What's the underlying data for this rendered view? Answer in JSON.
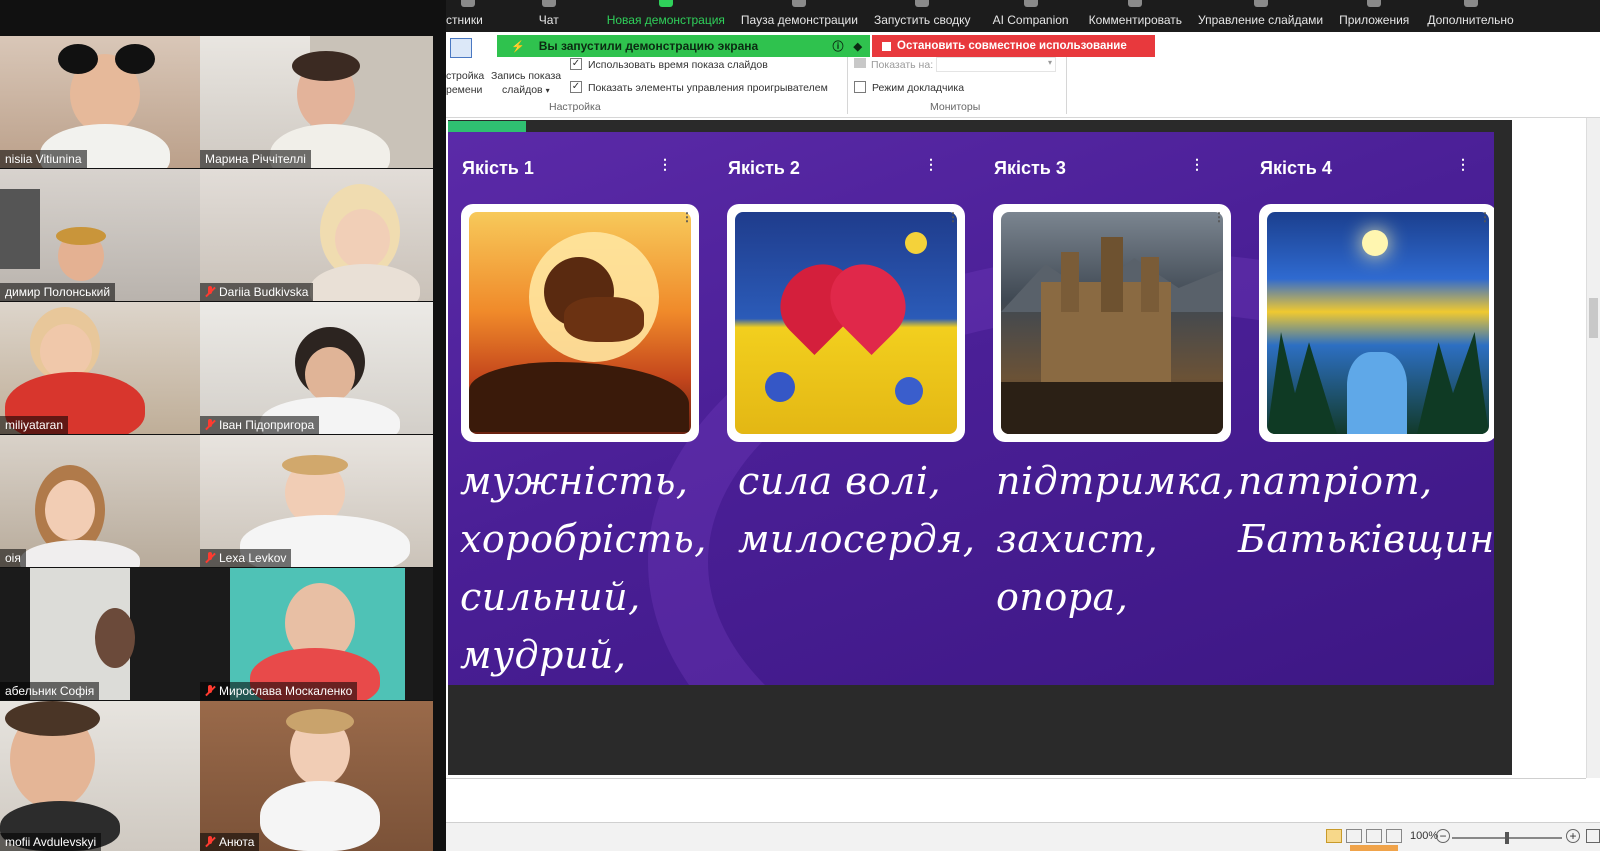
{
  "zoom_toolbar": {
    "items": [
      {
        "label": "стники",
        "accent": false
      },
      {
        "label": "Чат",
        "accent": false
      },
      {
        "label": "Новая демонстрация",
        "accent": true
      },
      {
        "label": "Пауза демонстрации",
        "accent": false
      },
      {
        "label": "Запустить сводку",
        "accent": false
      },
      {
        "label": "AI Companion",
        "accent": false
      },
      {
        "label": "Комментировать",
        "accent": false
      },
      {
        "label": "Управление слайдами",
        "accent": false
      },
      {
        "label": "Приложения",
        "accent": false
      },
      {
        "label": "Дополнительно",
        "accent": false
      }
    ]
  },
  "share_banner": {
    "status_text": "Вы запустили демонстрацию экрана",
    "stop_label": "Остановить совместное использование"
  },
  "ribbon": {
    "timing_label_1": "стройка",
    "timing_label_2": "ремени",
    "record_label_1": "Запись показа",
    "record_label_2": "слайдов",
    "use_timings": {
      "label": "Использовать время показа слайдов",
      "checked": true
    },
    "show_media_controls": {
      "label": "Показать элементы управления проигрывателем",
      "checked": true
    },
    "show_on_label": "Показать на:",
    "presenter_view": {
      "label": "Режим докладчика",
      "checked": false
    },
    "group_setup": "Настройка",
    "group_monitors": "Мониторы"
  },
  "participants": [
    {
      "name": "nisiia Vitiunina",
      "muted": false,
      "active": false
    },
    {
      "name": "Марина Річчітеллі",
      "muted": false,
      "active": true
    },
    {
      "name": "димир Полонський",
      "muted": false,
      "active": false
    },
    {
      "name": "Dariia Budkivska",
      "muted": true,
      "active": false
    },
    {
      "name": "miliyataran",
      "muted": false,
      "active": false
    },
    {
      "name": "Іван Підопригора",
      "muted": true,
      "active": false
    },
    {
      "name": "оія",
      "muted": false,
      "active": false
    },
    {
      "name": "Lexa Levkov",
      "muted": true,
      "active": false
    },
    {
      "name": "абельник Софія",
      "muted": false,
      "active": false
    },
    {
      "name": "Мирослава Москаленко",
      "muted": true,
      "active": false
    },
    {
      "name": "mofii Avdulevskyi",
      "muted": false,
      "active": false
    },
    {
      "name": "Анюта",
      "muted": true,
      "active": false
    }
  ],
  "slide": {
    "columns": [
      {
        "title": "Якість 1",
        "image": "lion-sunset",
        "text": "мужність,\nхоробрість,\nсильний,\nмудрий,"
      },
      {
        "title": "Якість 2",
        "image": "heart-thorns",
        "text": "сила волі,\nмилосердя,"
      },
      {
        "title": "Якість 3",
        "image": "castle-mountains",
        "text": "підтримка,\nзахист,\nопора,"
      },
      {
        "title": "Якість 4",
        "image": "ukraine-landscape",
        "text": "патріот,\nБатьківщина."
      }
    ]
  },
  "status_bar": {
    "zoom": "100%",
    "zoom_level": 0.5
  },
  "colors": {
    "share_green": "#2fc24e",
    "stop_red": "#e8393d",
    "slide_purple": "#4a1f96",
    "active_speaker": "#e8e64a"
  }
}
